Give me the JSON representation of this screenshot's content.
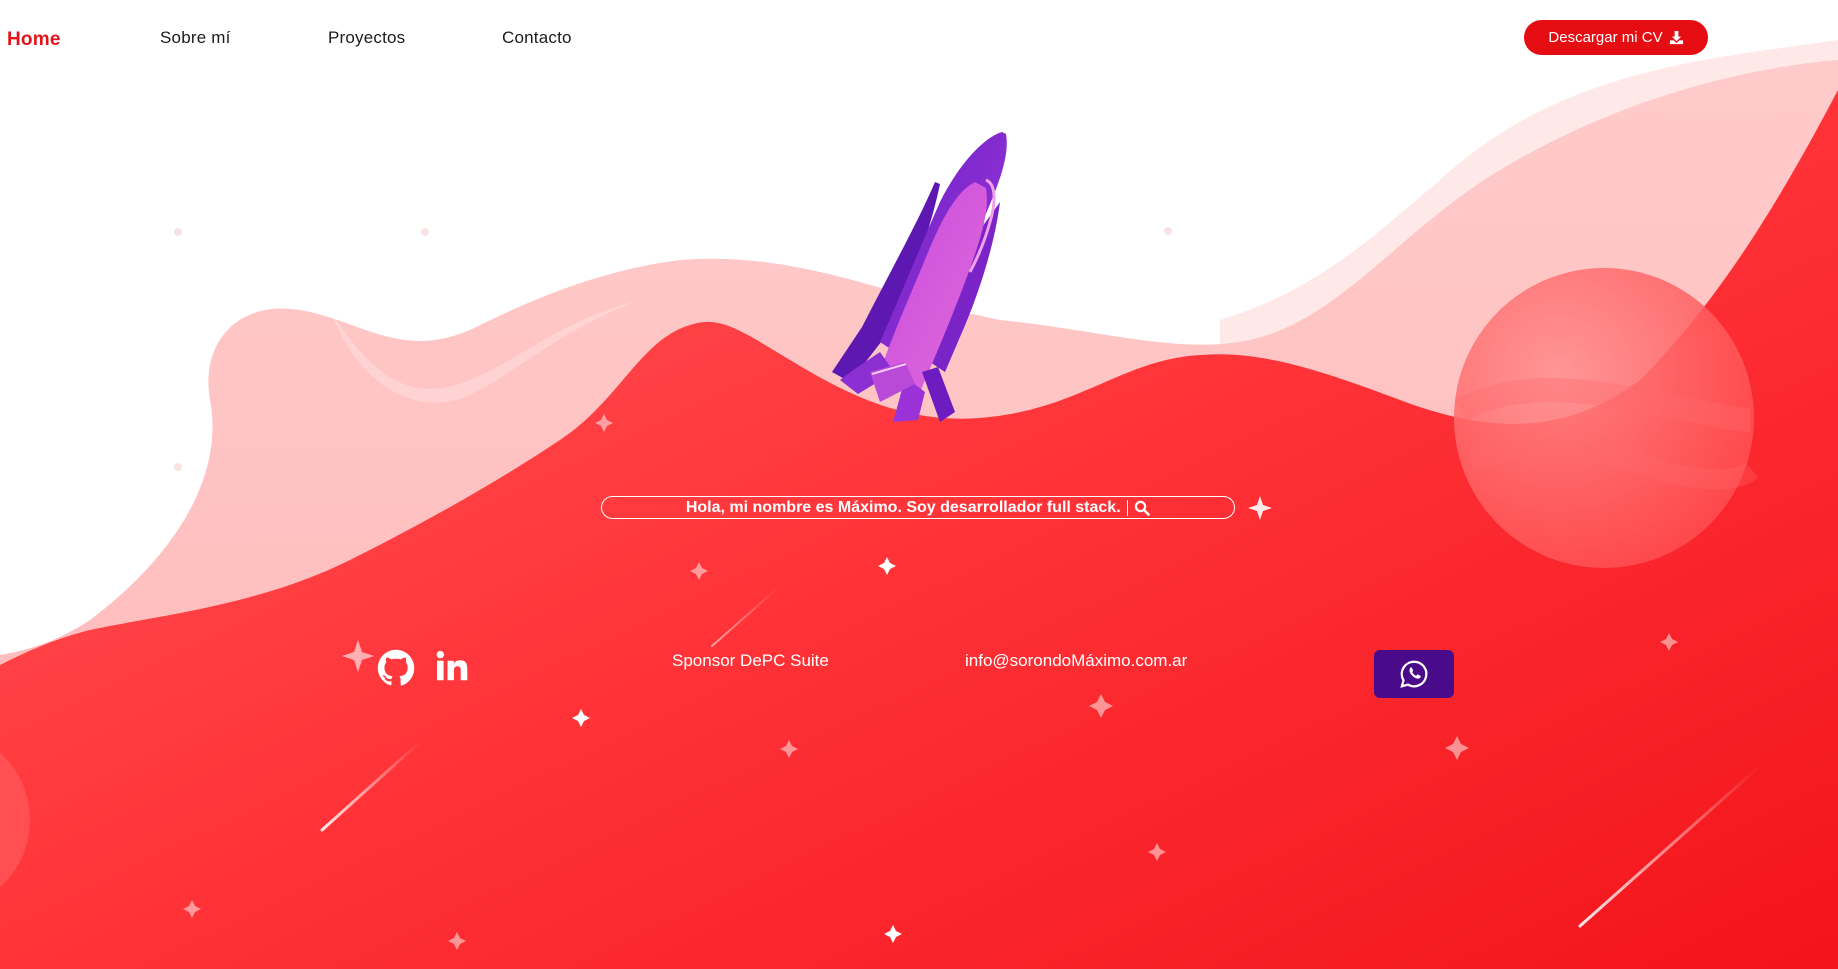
{
  "nav": {
    "home": "Home",
    "about": "Sobre mí",
    "projects": "Proyectos",
    "contact": "Contacto",
    "cv_button": "Descargar mi CV"
  },
  "hero": {
    "intro": "Hola, mi nombre es Máximo. Soy desarrollador full stack."
  },
  "footer": {
    "sponsor": "Sponsor DePC Suite",
    "email": "info@sorondoMáximo.com.ar"
  },
  "icons": {
    "cv": "download-icon",
    "intro": "search-icon",
    "social_1": "github-icon",
    "social_2": "linkedin-icon",
    "chat": "whatsapp-icon"
  },
  "colors": {
    "brand_red": "#e60d12",
    "active_link": "#e3141b",
    "rocket_purple": "#7a24c8",
    "whatsapp_button": "#4a0b8a",
    "background": "#ffffff"
  }
}
